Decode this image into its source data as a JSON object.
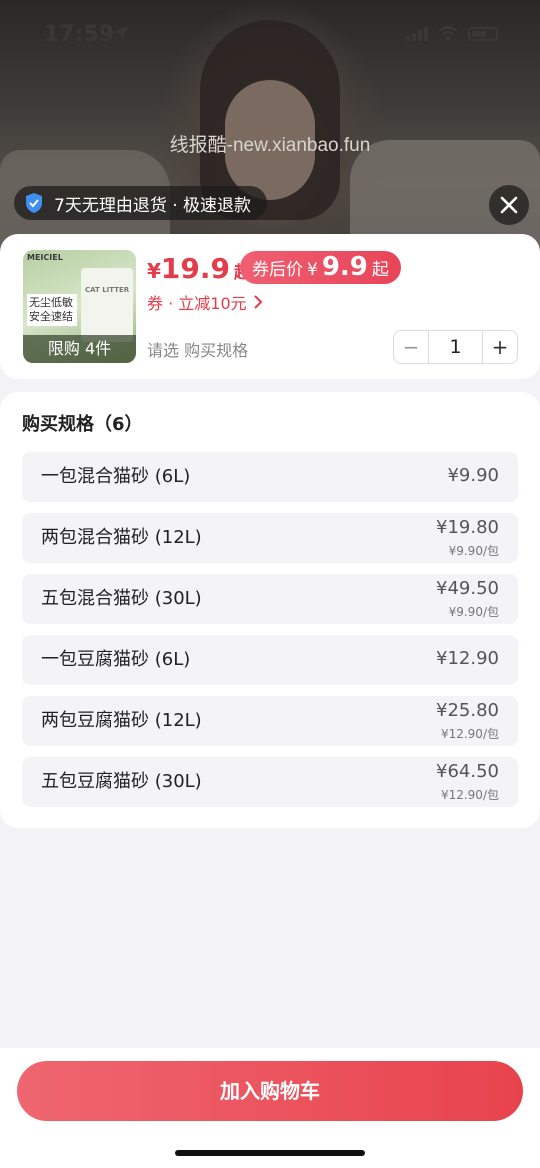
{
  "status_bar": {
    "time": "17:59"
  },
  "watermark": "线报酷-new.xianbao.fun",
  "return_policy": "7天无理由退货 · 极速退款",
  "product": {
    "thumb_brand": "MEICIEL",
    "thumb_tag": "无尘低敏 安全速结",
    "thumb_bag_label": "CAT LITTER",
    "limit_label": "限购 4件",
    "price_symbol": "¥",
    "price_value": "19.9",
    "price_suffix": "起",
    "after_coupon_label": "券后价",
    "after_coupon_symbol": "¥",
    "after_coupon_value": "9.9",
    "after_coupon_suffix": "起",
    "coupon_text": "券 · 立减10元",
    "spec_hint": "请选 购买规格",
    "quantity": "1",
    "minus": "−",
    "plus": "+"
  },
  "specs": {
    "title": "购买规格（6）",
    "items": [
      {
        "name": "一包混合猫砂 (6L)",
        "price": "¥9.90",
        "unit": ""
      },
      {
        "name": "两包混合猫砂 (12L)",
        "price": "¥19.80",
        "unit": "¥9.90/包"
      },
      {
        "name": "五包混合猫砂 (30L)",
        "price": "¥49.50",
        "unit": "¥9.90/包"
      },
      {
        "name": "一包豆腐猫砂 (6L)",
        "price": "¥12.90",
        "unit": ""
      },
      {
        "name": "两包豆腐猫砂 (12L)",
        "price": "¥25.80",
        "unit": "¥12.90/包"
      },
      {
        "name": "五包豆腐猫砂 (30L)",
        "price": "¥64.50",
        "unit": "¥12.90/包"
      }
    ]
  },
  "cart_button": "加入购物车",
  "colors": {
    "accent": "#e33c4b",
    "button": "#e8434d"
  }
}
